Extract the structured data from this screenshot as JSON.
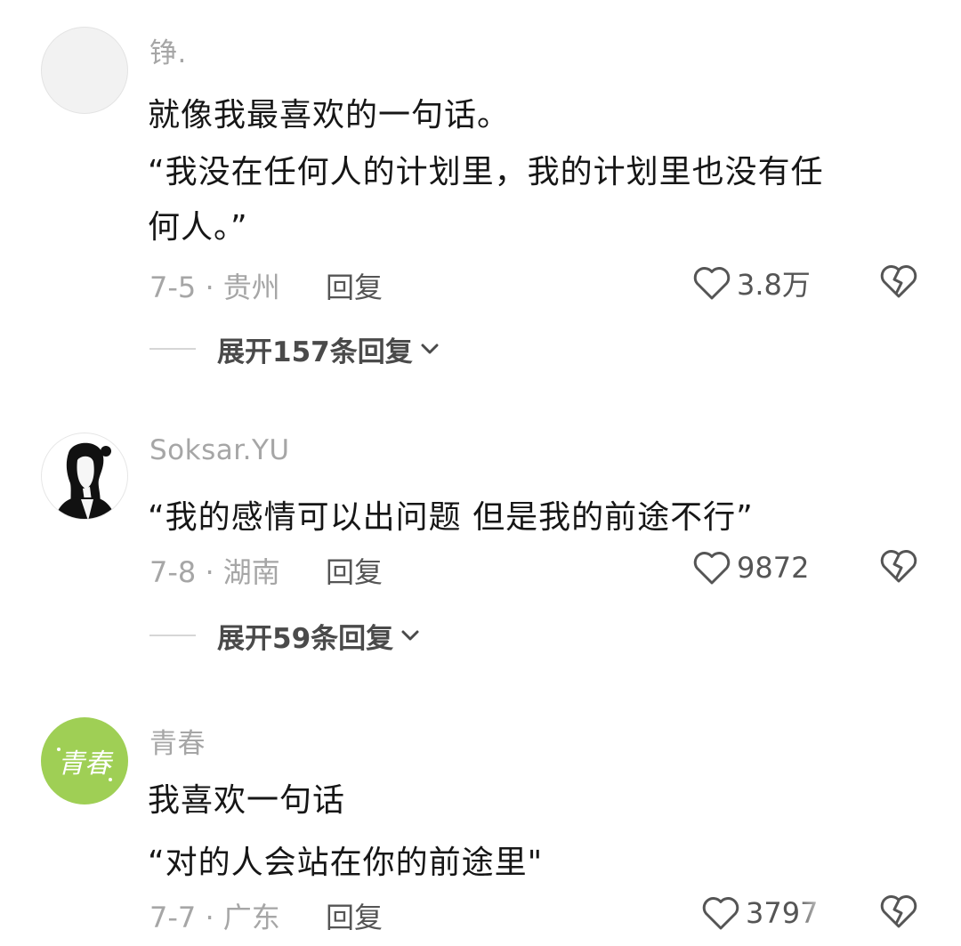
{
  "comments": [
    {
      "username": "铮.",
      "lines": [
        "就像我最喜欢的一句话。",
        "“我没在任何人的计划里，我的计划里也没有任",
        "何人。”"
      ],
      "meta": "7-5 · 贵州",
      "reply_label": "回复",
      "likes": "3.8万",
      "expand_label": "展开157条回复",
      "avatar_icon": "blank-avatar"
    },
    {
      "username": "Soksar.YU",
      "lines": [
        "“我的感情可以出问题 但是我的前途不行”"
      ],
      "meta": "7-8 · 湖南",
      "reply_label": "回复",
      "likes": "9872",
      "expand_label": "展开59条回复",
      "avatar_icon": "sketch-girl-avatar"
    },
    {
      "username": "青春",
      "lines": [
        "我喜欢一句话",
        "“对的人会站在你的前途里\""
      ],
      "meta": "7-7 · 广东",
      "reply_label": "回复",
      "likes": "3797",
      "avatar_icon": "green-calligraphy-avatar",
      "avatar_text": "青春"
    }
  ],
  "colors": {
    "username": "#a6a6a6",
    "body_text": "#161616",
    "meta": "#a6a6a6",
    "action": "#555555",
    "avatar_green": "#9fcf55"
  },
  "icons": [
    "heart-outline-icon",
    "broken-heart-icon",
    "chevron-down-icon"
  ]
}
